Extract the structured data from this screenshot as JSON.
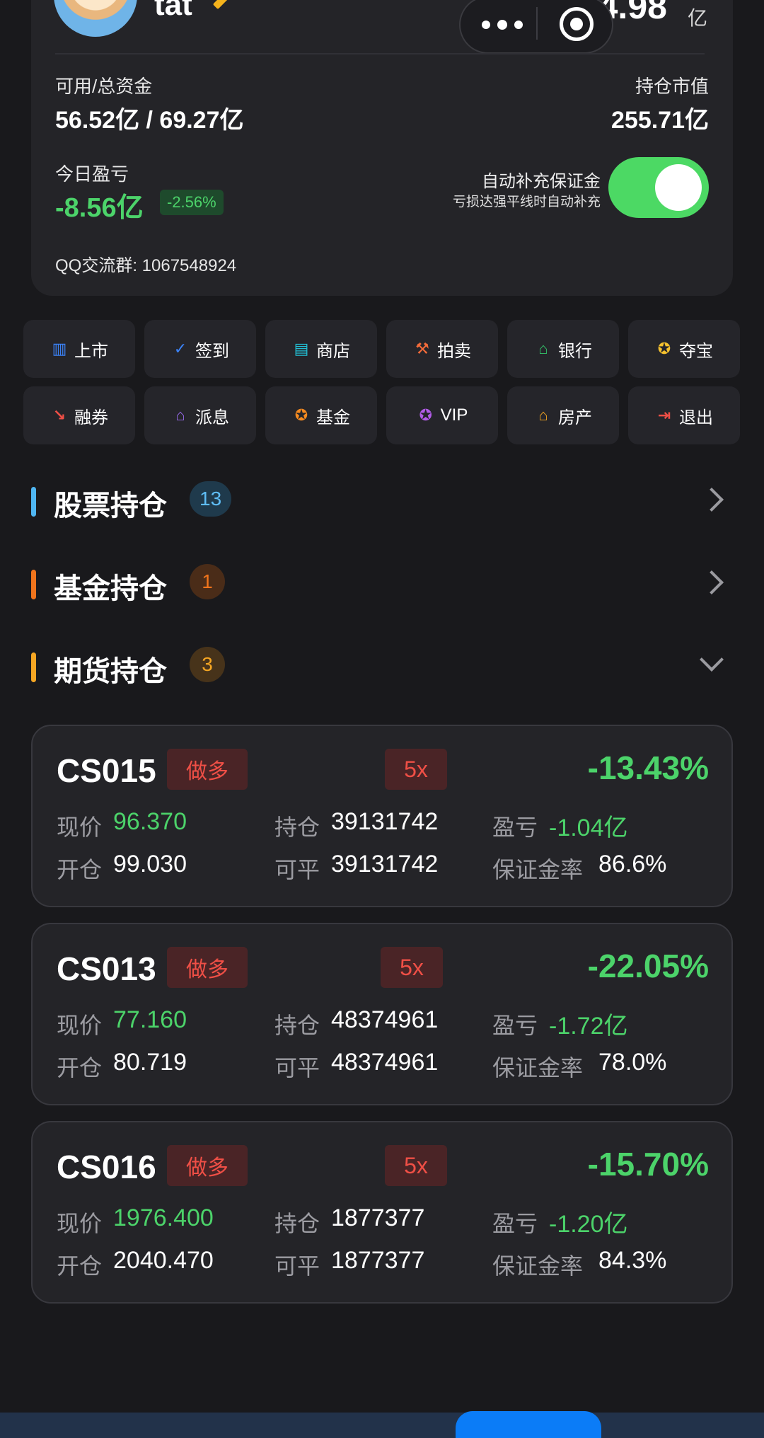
{
  "header": {
    "username": "tat",
    "total_value": "324.98",
    "total_unit": "亿"
  },
  "summary": {
    "available_label": "可用/总资金",
    "available_value": "56.52亿 / 69.27亿",
    "holding_label": "持仓市值",
    "holding_value": "255.71亿",
    "pnl_label": "今日盈亏",
    "pnl_value": "-8.56亿",
    "pnl_pct": "-2.56%",
    "auto_margin_label": "自动补充保证金",
    "auto_margin_sub": "亏损达强平线时自动补充",
    "auto_margin_on": true,
    "qq_group": "QQ交流群: 1067548924"
  },
  "menu": [
    {
      "label": "上市",
      "icon": "building-icon",
      "color": "#3b82f6"
    },
    {
      "label": "签到",
      "icon": "check-circle-icon",
      "color": "#3b82f6"
    },
    {
      "label": "商店",
      "icon": "store-icon",
      "color": "#22c1d6"
    },
    {
      "label": "拍卖",
      "icon": "gavel-icon",
      "color": "#f26b3a"
    },
    {
      "label": "银行",
      "icon": "bank-icon",
      "color": "#33c46a"
    },
    {
      "label": "夺宝",
      "icon": "star-circle-icon",
      "color": "#f5c12e"
    },
    {
      "label": "融券",
      "icon": "trend-down-icon",
      "color": "#ef4f46"
    },
    {
      "label": "派息",
      "icon": "bank-icon",
      "color": "#9a6cf0"
    },
    {
      "label": "基金",
      "icon": "star-circle-icon",
      "color": "#f58a1f"
    },
    {
      "label": "VIP",
      "icon": "medal-icon",
      "color": "#b25ce8"
    },
    {
      "label": "房产",
      "icon": "house-icon",
      "color": "#f5a623"
    },
    {
      "label": "退出",
      "icon": "logout-icon",
      "color": "#ef4f46"
    }
  ],
  "sections": [
    {
      "title": "股票持仓",
      "count": "13",
      "bar_color": "#4fb6f2",
      "badge_bg": "#1f3a4c",
      "badge_fg": "#5fbdf5",
      "state": "collapsed"
    },
    {
      "title": "基金持仓",
      "count": "1",
      "bar_color": "#f0741c",
      "badge_bg": "#4a2c18",
      "badge_fg": "#f0741c",
      "state": "collapsed"
    },
    {
      "title": "期货持仓",
      "count": "3",
      "bar_color": "#f5a623",
      "badge_bg": "#47331a",
      "badge_fg": "#f5a623",
      "state": "expanded"
    }
  ],
  "labels": {
    "price": "现价",
    "open": "开仓",
    "hold": "持仓",
    "closable": "可平",
    "pnl": "盈亏",
    "margin_rate": "保证金率"
  },
  "futures": [
    {
      "code": "CS015",
      "direction": "做多",
      "leverage": "5x",
      "pct": "-13.43%",
      "price": "96.370",
      "open": "99.030",
      "hold": "39131742",
      "closable": "39131742",
      "pnl": "-1.04亿",
      "margin_rate": "86.6%"
    },
    {
      "code": "CS013",
      "direction": "做多",
      "leverage": "5x",
      "pct": "-22.05%",
      "price": "77.160",
      "open": "80.719",
      "hold": "48374961",
      "closable": "48374961",
      "pnl": "-1.72亿",
      "margin_rate": "78.0%"
    },
    {
      "code": "CS016",
      "direction": "做多",
      "leverage": "5x",
      "pct": "-15.70%",
      "price": "1976.400",
      "open": "2040.470",
      "hold": "1877377",
      "closable": "1877377",
      "pnl": "-1.20亿",
      "margin_rate": "84.3%"
    }
  ]
}
